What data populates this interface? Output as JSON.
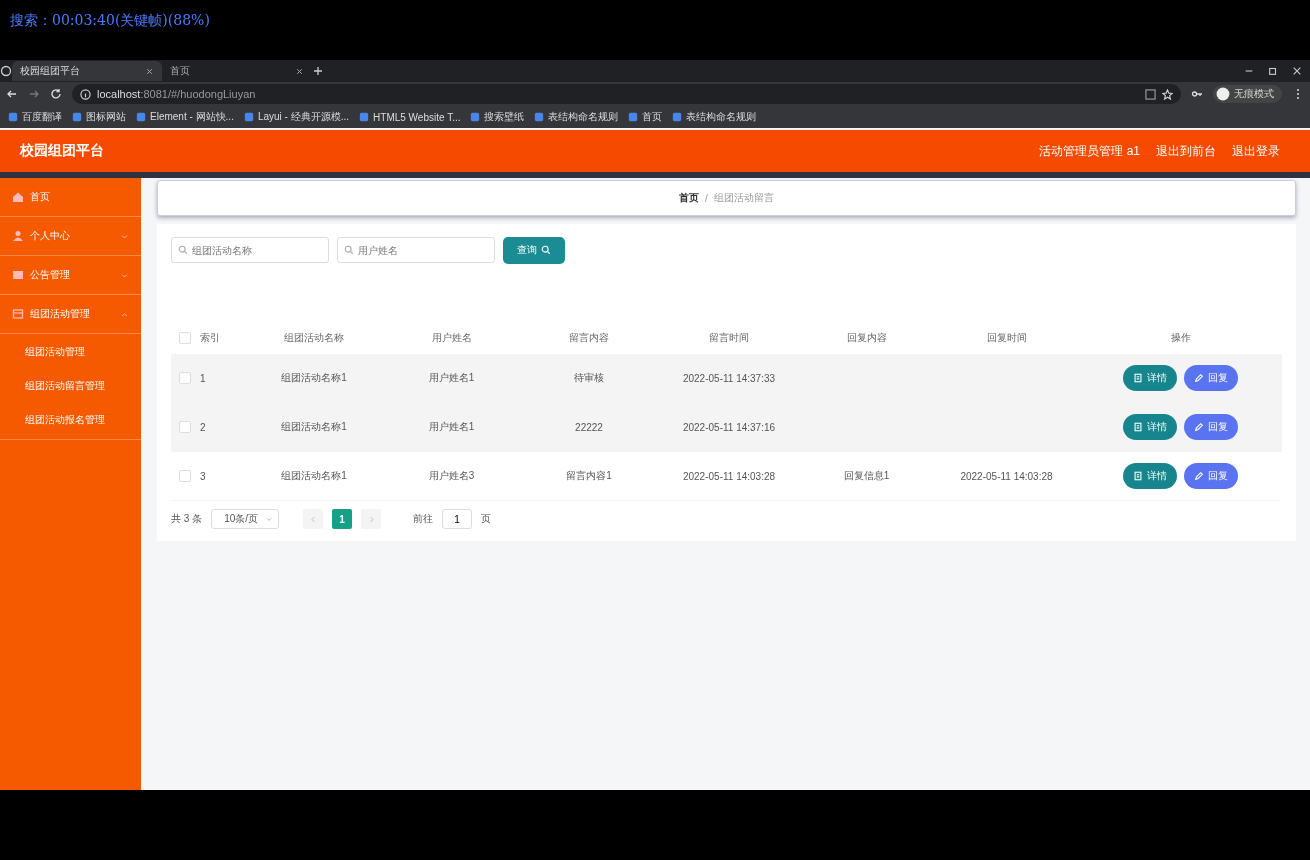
{
  "player_overlay": "搜索：00:03:40(关键帧)(88%)",
  "browser": {
    "tabs": [
      {
        "title": "校园组团平台",
        "selected": true
      },
      {
        "title": "首页",
        "selected": false
      }
    ],
    "url_host": "localhost",
    "url_rest": ":8081/#/huodongLiuyan",
    "profile": "无痕模式",
    "bookmarks": [
      "百度翻译",
      "图标网站",
      "Element - 网站快...",
      "Layui - 经典开源模...",
      "HTML5 Website T...",
      "搜索壁纸",
      "表结构命名规则",
      "首页",
      "表结构命名规则"
    ]
  },
  "header": {
    "title": "校园组团平台",
    "links": [
      "活动管理员管理 a1",
      "退出到前台",
      "退出登录"
    ]
  },
  "sidebar": {
    "items": [
      {
        "label": "首页"
      },
      {
        "label": "个人中心",
        "expanded": false
      },
      {
        "label": "公告管理",
        "expanded": false
      },
      {
        "label": "组团活动管理",
        "expanded": true,
        "children": [
          {
            "label": "组团活动管理"
          },
          {
            "label": "组团活动留言管理"
          },
          {
            "label": "组团活动报名管理"
          }
        ]
      }
    ]
  },
  "breadcrumb": {
    "items": [
      "首页",
      "组团活动留言"
    ],
    "separator": "/"
  },
  "search": {
    "fields": [
      {
        "placeholder": "组团活动名称"
      },
      {
        "placeholder": "用户姓名"
      }
    ],
    "button": "查询"
  },
  "table": {
    "select_all_checked": false,
    "columns": [
      "索引",
      "组团活动名称",
      "用户姓名",
      "留言内容",
      "留言时间",
      "回复内容",
      "回复时间",
      "操作"
    ],
    "rows": [
      {
        "checked": false,
        "cells": [
          "1",
          "组团活动名称1",
          "用户姓名1",
          "待审核",
          "2022-05-11 14:37:33",
          "",
          ""
        ],
        "actions": [
          "详情",
          "回复"
        ]
      },
      {
        "checked": false,
        "cells": [
          "2",
          "组团活动名称1",
          "用户姓名1",
          "22222",
          "2022-05-11 14:37:16",
          "",
          ""
        ],
        "actions": [
          "详情",
          "回复"
        ]
      },
      {
        "checked": false,
        "cells": [
          "3",
          "组团活动名称1",
          "用户姓名3",
          "留言内容1",
          "2022-05-11 14:03:28",
          "回复信息1",
          "2022-05-11 14:03:28"
        ],
        "actions": [
          "详情",
          "回复"
        ]
      }
    ]
  },
  "pagination": {
    "total": "共 3 条",
    "page_size": "10条/页",
    "pages": [
      {
        "label": "1",
        "selected": true
      }
    ],
    "goto_label": "前往",
    "goto_value": "1",
    "goto_suffix": "页"
  }
}
